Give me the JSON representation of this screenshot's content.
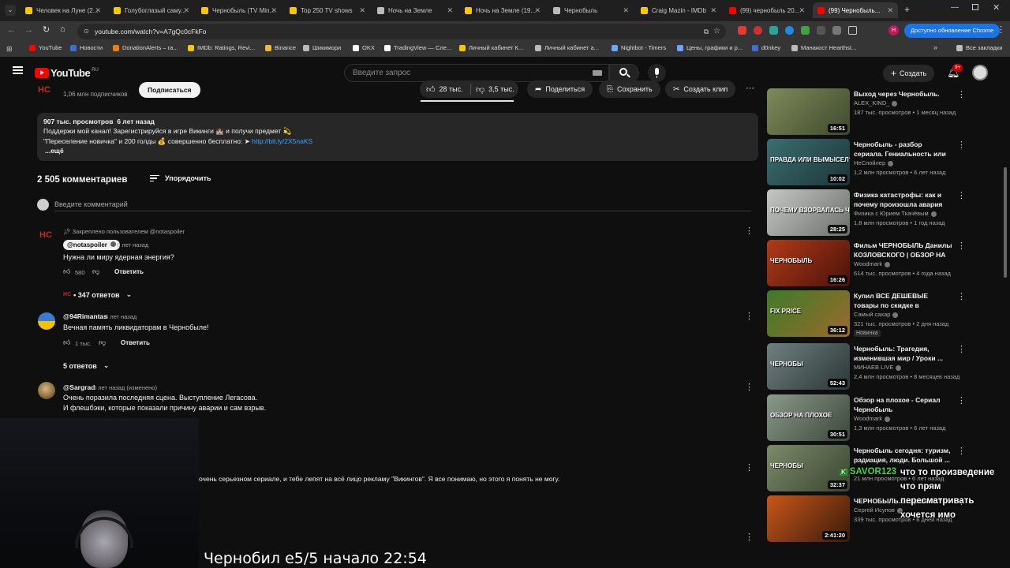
{
  "browser": {
    "tabs": [
      {
        "label": "Человек на Луне (2...",
        "color": "#f7c800"
      },
      {
        "label": "Голубоглазый саму...",
        "color": "#f7c800"
      },
      {
        "label": "Чернобыль (TV Min...",
        "color": "#f7c800"
      },
      {
        "label": "Top 250 TV shows",
        "color": "#f7c800"
      },
      {
        "label": "Ночь на Земле",
        "color": "#bbbbbb"
      },
      {
        "label": "Ночь на Земле (19...",
        "color": "#f7c800"
      },
      {
        "label": "Чернобыль",
        "color": "#bbbbbb"
      },
      {
        "label": "Craig Mazin - IMDb",
        "color": "#f7c800"
      },
      {
        "label": "(99) чернобыль 20...",
        "color": "#ff0000"
      },
      {
        "label": "(99) Чернобыль...",
        "color": "#ff0000"
      }
    ],
    "url": "youtube.com/watch?v=A7gQc0cFkFo",
    "update_label": "Доступно обновление Chrome",
    "bookmarks": [
      {
        "label": "YouTube",
        "color": "#ff0000"
      },
      {
        "label": "Новости",
        "color": "#3d6fd8"
      },
      {
        "label": "DonationAlerts – га...",
        "color": "#f57c00"
      },
      {
        "label": "IMDb: Ratings, Revi...",
        "color": "#f7c800"
      },
      {
        "label": "Binance",
        "color": "#f3ba2f"
      },
      {
        "label": "Шикимори",
        "color": "#bbbbbb"
      },
      {
        "label": "OKX",
        "color": "#ffffff"
      },
      {
        "label": "TradingView — Сле...",
        "color": "#ffffff"
      },
      {
        "label": "Личный кабинет К...",
        "color": "#f7c800"
      },
      {
        "label": "Личный кабинет а...",
        "color": "#bbbbbb"
      },
      {
        "label": "Nightbot - Timers",
        "color": "#6aa8ff"
      },
      {
        "label": "Цены, графики и р...",
        "color": "#6aa8ff"
      },
      {
        "label": "d0nkey",
        "color": "#3d6fd8"
      },
      {
        "label": "Манакост Hearthst...",
        "color": "#bbbbbb"
      }
    ],
    "all_bookmarks": "Все закладки"
  },
  "youtube": {
    "logo": "YouTube",
    "logo_region": "RU",
    "search_placeholder": "Введите запрос",
    "create_label": "Создать",
    "notif_count": "9+"
  },
  "video": {
    "subscribers": "1,06 млн подписчиков",
    "subscribe_label": "Подписаться",
    "likes": "28 тыс.",
    "dislikes": "3,5 тыс.",
    "share_label": "Поделиться",
    "save_label": "Сохранить",
    "clip_label": "Создать клип",
    "views": "907 тыс. просмотров",
    "date": "6 лет назад",
    "desc_line1": "Поддержи мой канал! Зарегистрируйся в игре Викинги 🏰 и получи предмет 💫",
    "desc_line2_pre": "\"Переселение новичка\" и 200 голды 💰 совершенно бесплатно: ➤",
    "desc_link": "http://bit.ly/2X5naKS",
    "more_label": "...ещё"
  },
  "comments": {
    "count_label": "2 505 комментариев",
    "sort_label": "Упорядочить",
    "input_placeholder": "Введите комментарий",
    "items": [
      {
        "pinned": "Закреплено пользователем @notaspoiler",
        "author": "@notaspoiler",
        "time": "6 лет назад",
        "text": "Нужна ли миру ядерная энергия?",
        "likes": "580",
        "reply_label": "Ответить",
        "replies": "• 347 ответов"
      },
      {
        "author": "@94Rimantas",
        "time": "6 лет назад",
        "text": "Вечная память ликвидаторам в Чернобыле!",
        "likes": "1 тыс.",
        "reply_label": "Ответить",
        "replies": "5 ответов"
      },
      {
        "author": "@Sargrad",
        "time": "6 лет назад (изменено)",
        "text1": "Очень поразила последняя сцена. Выступление Легасова.",
        "text2": "И флешбэки, которые показали причину аварии и сам взрыв."
      },
      {
        "text": "очень серьезном сериале, и тебе лепят на всё лицо рекламу \"Викингов\". Я все понимаю, но этого я понять не могу."
      }
    ]
  },
  "related": [
    {
      "title": "Выход через Чернобыль.",
      "channel": "ALEX_KIND_",
      "meta": "187 тыс. просмотров • 1 месяц назад",
      "duration": "16:51",
      "c1": "#7f8a5c",
      "c2": "#3e4a2c"
    },
    {
      "title": "Чернобыль - разбор сериала. Гениальность или ложь?",
      "channel": "НеСпойлер",
      "meta": "1,2 млн просмотров • 6 лет назад",
      "duration": "10:02",
      "c1": "#3a6e70",
      "c2": "#1d3638",
      "thumb_text": "ПРАВДА ИЛИ ВЫМЫСЕЛ?"
    },
    {
      "title": "Физика катастрофы: как и почему произошла авария н...",
      "channel": "Физика с Юрием Ткачёвым",
      "meta": "1,8 млн просмотров • 1 год назад",
      "duration": "28:25",
      "c1": "#c5c7c4",
      "c2": "#6b6f6a",
      "thumb_text": "ПОЧЕМУ ВЗОРВАЛАСЬ ЧАЭС?"
    },
    {
      "title": "Фильм ЧЕРНОБЫЛЬ Данилы КОЗЛОВСКОГО | ОБЗОР НА ...",
      "channel": "Woodmark",
      "meta": "614 тыс. просмотров • 4 года назад",
      "duration": "16:26",
      "c1": "#b03a1a",
      "c2": "#4a1208",
      "thumb_text": "ЧЕРНОБЫЛЬ"
    },
    {
      "title": "Купил ВСЕ ДЕШЕВЫЕ товары по скидке в FixPrice... зря",
      "channel": "Самый сахар",
      "meta": "321 тыс. просмотров • 2 дня назад",
      "badge": "Новинка",
      "duration": "36:12",
      "c1": "#3f7a2a",
      "c2": "#9a6b2a",
      "thumb_text": "FIX PRICE"
    },
    {
      "title": "Чернобыль: Трагедия, изменившая мир / Уроки ...",
      "channel": "МИНАЕВ LIVE",
      "meta": "2,4 млн просмотров • 8 месяцев назад",
      "duration": "52:43",
      "c1": "#6f8080",
      "c2": "#2c3636",
      "thumb_text": "ЧЕРНОБЫ"
    },
    {
      "title": "Обзор на плохое - Сериал Чернобыль",
      "channel": "Woodmark",
      "meta": "1,3 млн просмотров • 6 лет назад",
      "duration": "30:51",
      "c1": "#8a9a8a",
      "c2": "#3c463c",
      "thumb_text": "ОБЗОР НА ПЛОХОЕ"
    },
    {
      "title": "Чернобыль сегодня: туризм, радиация, люди. Большой ...",
      "channel": "",
      "meta": "21 млн просмотров • 6 лет назад",
      "duration": "32:37",
      "c1": "#7d8a6a",
      "c2": "#3a4430",
      "thumb_text": "ЧЕРНОБЫ"
    },
    {
      "title": "ЧЕРНОБЫЛЬ. ... врали???",
      "channel": "Сергей Исупов",
      "meta": "339 тыс. просмотров • 8 дней назад",
      "duration": "2:41:20",
      "c1": "#c9561a",
      "c2": "#3a1a0a"
    }
  ],
  "stream": {
    "title": "Чернобил е5/5  начало 22:54",
    "chat_user": "SAVOR123",
    "chat_lines": [
      "что то произведение",
      "что прям",
      "пересматривать",
      "хочется имо"
    ]
  }
}
